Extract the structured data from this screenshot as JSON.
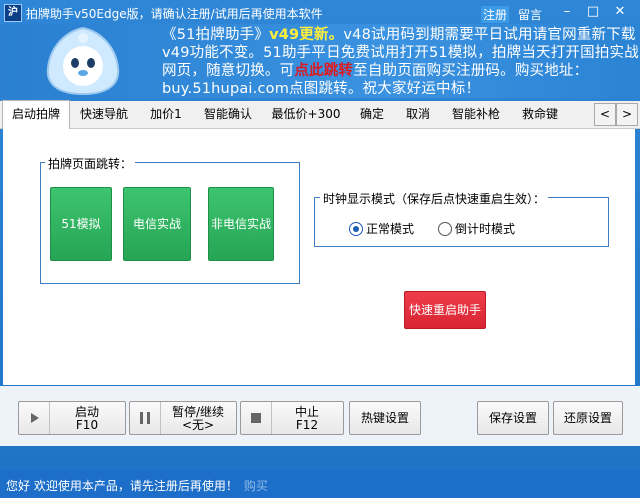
{
  "titlebar": {
    "app_icon_text": "沪",
    "title": "拍牌助手v50Edge版，请确认注册/试用后再使用本软件",
    "register_label": "注册",
    "message_label": "留言",
    "minimize_glyph": "–",
    "maximize_glyph": "□",
    "close_glyph": "✕"
  },
  "banner": {
    "part1": "《51拍牌助手》",
    "part2": "v49更新。",
    "part3": "v48试用码到期需要平日试用请官网重新下载v49功能不变。51助手平日免费试用打开51模拟，拍牌当天打开国拍实战网页，随意切换。可",
    "part4": "点此跳转",
    "part5": "至自助页面购买注册码。购买地址：buy.51hupai.com点图跳转。祝大家好运中标！"
  },
  "tabs": [
    {
      "label": "启动拍牌",
      "active": true
    },
    {
      "label": "快速导航",
      "active": false
    },
    {
      "label": "加价1",
      "active": false
    },
    {
      "label": "智能确认",
      "active": false
    },
    {
      "label": "最低价+300",
      "active": false
    },
    {
      "label": "确定",
      "active": false
    },
    {
      "label": "取消",
      "active": false
    },
    {
      "label": "智能补枪",
      "active": false
    },
    {
      "label": "救命键",
      "active": false
    }
  ],
  "tab_arrows": {
    "left": "<",
    "right": ">"
  },
  "page_jump": {
    "legend": "拍牌页面跳转：",
    "buttons": [
      "51模拟",
      "电信实战",
      "非电信实战"
    ]
  },
  "clock_mode": {
    "legend": "时钟显示模式（保存后点快速重启生效）：",
    "options": [
      {
        "label": "正常模式",
        "selected": true
      },
      {
        "label": "倒计时模式",
        "selected": false
      }
    ]
  },
  "restart_button": "快速重启助手",
  "controls": {
    "start": {
      "label": "启动",
      "key": "F10"
    },
    "pause": {
      "label": "暂停/继续",
      "key": "<无>"
    },
    "stop": {
      "label": "中止",
      "key": "F12"
    },
    "hotkey_settings": "热键设置",
    "save_settings": "保存设置",
    "restore_settings": "还原设置"
  },
  "status": {
    "message": "您好 欢迎使用本产品，请先注册后再使用！",
    "buy_label": "购买"
  },
  "colors": {
    "accent_blue": "#1f73c6",
    "green_button": "#26a555",
    "red_button": "#d92533",
    "banner_highlight_yellow": "#ffef3a",
    "banner_highlight_red": "#e0191e"
  }
}
